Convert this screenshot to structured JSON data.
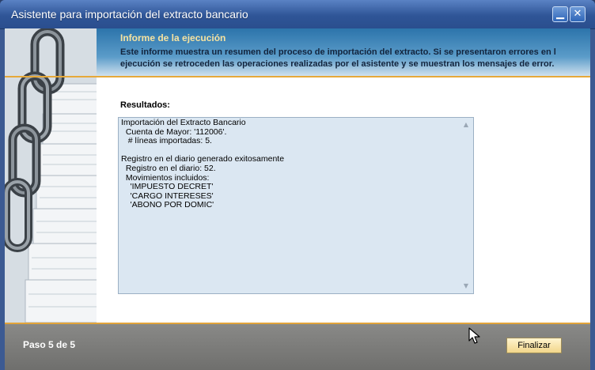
{
  "window": {
    "title": "Asistente para importación del extracto bancario",
    "minimize_icon": "minimize-icon",
    "close_icon": "close-icon"
  },
  "header": {
    "title": "Informe de la ejecución",
    "description_line1": "Este informe muestra un resumen del proceso de importación del extracto.  Si se presentaron errores en l",
    "description_line2": "ejecución se retroceden las operaciones realizadas por el asistente y se muestran los mensajes de error."
  },
  "results": {
    "label": "Resultados:",
    "text": "Importación del Extracto Bancario\n  Cuenta de Mayor: '112006'.\n   # líneas importadas: 5.\n\nRegistro en el diario generado exitosamente\n  Registro en el diario: 52.\n  Movimientos incluidos:\n    'IMPUESTO DECRET'\n    'CARGO INTERESES'\n    'ABONO POR DOMIC'"
  },
  "footer": {
    "step": "Paso 5 de 5",
    "finish_label": "Finalizar"
  },
  "colors": {
    "title_bar": "#2f5597",
    "header_accent": "#f6e3a1",
    "separator": "#e6a93a",
    "results_bg": "#dbe7f2",
    "footer_bg": "#7d7d7b"
  }
}
